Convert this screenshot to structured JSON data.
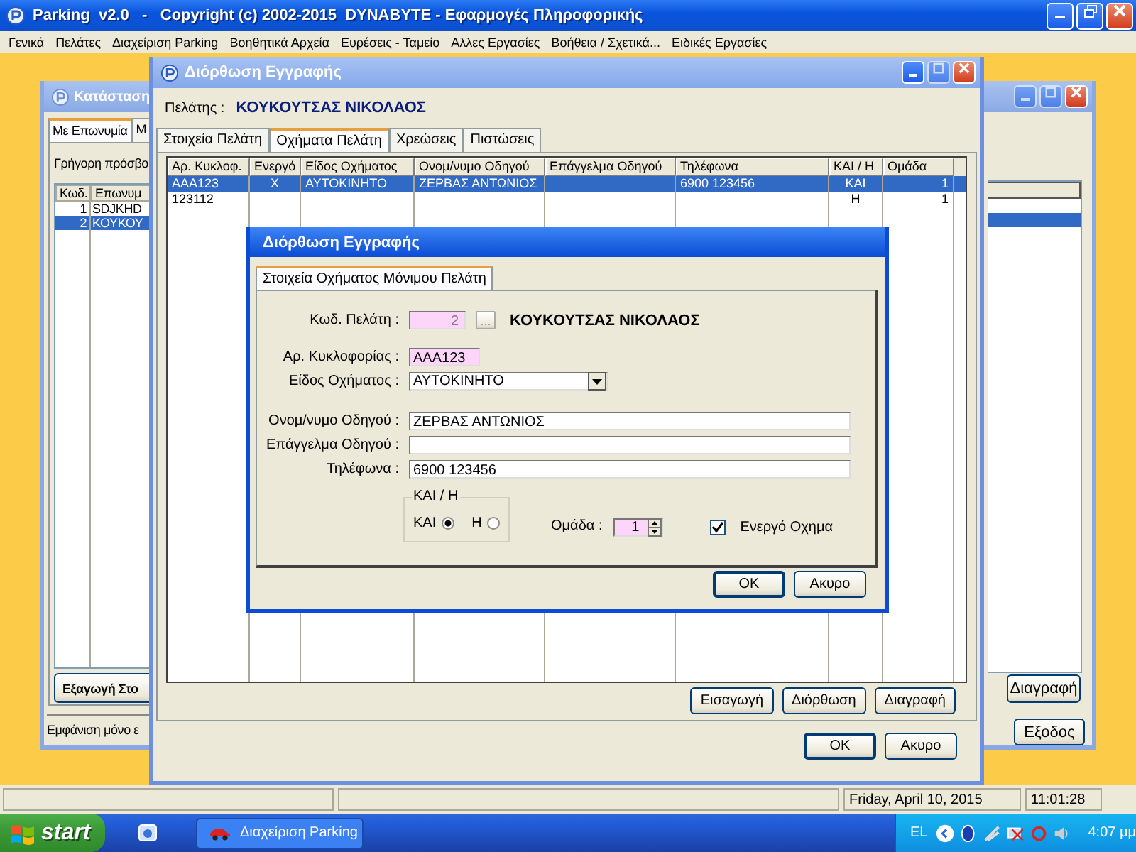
{
  "app": {
    "title": "Parking  v2.0   -   Copyright (c) 2002-2015  DYNABYTE - Εφαρμογές Πληροφορικής",
    "menu": [
      "Γενικά",
      "Πελάτες",
      "Διαχείριση Parking",
      "Βοηθητικά Αρχεία",
      "Ευρέσεις - Ταμείο",
      "Αλλες Εργασίες",
      "Βοήθεια / Σχετικά...",
      "Ειδικές Εργασίες"
    ]
  },
  "status_window": {
    "title": "Κατάσταση",
    "tabs": [
      {
        "label": "Με Επωνυμία",
        "selected": true
      },
      {
        "label": "Μ",
        "selected": false
      }
    ],
    "quick_access_label": "Γρήγορη πρόσβο",
    "columns": [
      "Κωδ.",
      "Επωνυμ"
    ],
    "rows": [
      {
        "code": "1",
        "name": "SDJKHD",
        "selected": false
      },
      {
        "code": "2",
        "name": "ΚΟΥΚΟΥ",
        "selected": true
      }
    ],
    "export_button": "Εξαγωγή Στο",
    "footer_text": "Εμφάνιση μόνο ε",
    "delete_button": "Διαγραφή",
    "exit_button": "Εξοδος"
  },
  "customer_window": {
    "title": "Διόρθωση Εγγραφής",
    "customer_label": "Πελάτης :",
    "customer_name": "ΚΟΥΚΟΥΤΣΑΣ ΝΙΚΟΛΑΟΣ",
    "tabs": [
      {
        "label": "Στοιχεία Πελάτη",
        "selected": false
      },
      {
        "label": "Οχήματα Πελάτη",
        "selected": true
      },
      {
        "label": "Χρεώσεις",
        "selected": false
      },
      {
        "label": "Πιστώσεις",
        "selected": false
      }
    ],
    "columns": [
      "Αρ. Κυκλοφ.",
      "Ενεργό",
      "Είδος Οχήματος",
      "Ονομ/νυμο Οδηγού",
      "Επάγγελμα Οδηγού",
      "Τηλέφωνα",
      "ΚΑΙ / Η",
      "Ομάδα"
    ],
    "rows": [
      {
        "plate": "ΑΑΑ123",
        "active": "X",
        "type": "ΑΥΤΟΚΙΝΗΤΟ",
        "driver": "ΖΕΡΒΑΣ ΑΝΤΩΝΙΟΣ",
        "phone": "6900 123456",
        "and_or": "ΚΑΙ",
        "group": "1",
        "selected": true
      },
      {
        "plate": "123112",
        "and_or": "Η",
        "group": "1",
        "selected": false
      }
    ],
    "buttons": [
      "Εισαγωγή",
      "Διόρθωση",
      "Διαγραφή"
    ],
    "ok_button": "OK",
    "cancel_button": "Ακυρο"
  },
  "edit_dialog": {
    "title": "Διόρθωση Εγγραφής",
    "tab": "Στοιχεία Οχήματος Μόνιμου Πελάτη",
    "customer_code": {
      "label": "Κωδ. Πελάτη :",
      "value": "2",
      "disabled": true
    },
    "lookup_button": "...",
    "customer_name": "ΚΟΥΚΟΥΤΣΑΣ ΝΙΚΟΛΑΟΣ",
    "plate": {
      "label": "Αρ. Κυκλοφορίας :",
      "value": "ΑΑΑ123"
    },
    "vehicle_type": {
      "label": "Είδος Οχήματος :",
      "value": "ΑΥΤΟΚΙΝΗΤΟ"
    },
    "driver_name": {
      "label": "Ονομ/νυμο Οδηγού :",
      "value": "ΖΕΡΒΑΣ ΑΝΤΩΝΙΟΣ"
    },
    "driver_profession": {
      "label": "Επάγγελμα Οδηγού :"
    },
    "phones": {
      "label": "Τηλέφωνα :",
      "value": "6900 123456"
    },
    "and_or": {
      "title": "ΚΑΙ / Η",
      "options": [
        {
          "label": "ΚΑΙ",
          "selected": true
        },
        {
          "label": "Η",
          "selected": false
        }
      ]
    },
    "group": {
      "label": "Ομάδα :",
      "value": "1"
    },
    "active_vehicle": {
      "label": "Ενεργό Οχημα",
      "checked": true
    },
    "ok_button": "OK",
    "cancel_button": "Ακυρο"
  },
  "status_bar": {
    "date": "Friday, April 10, 2015",
    "time": "11:01:28"
  },
  "taskbar": {
    "start": "start",
    "task": "Διαχείριση Parking",
    "language": "EL",
    "clock": "4:07 μμ"
  }
}
